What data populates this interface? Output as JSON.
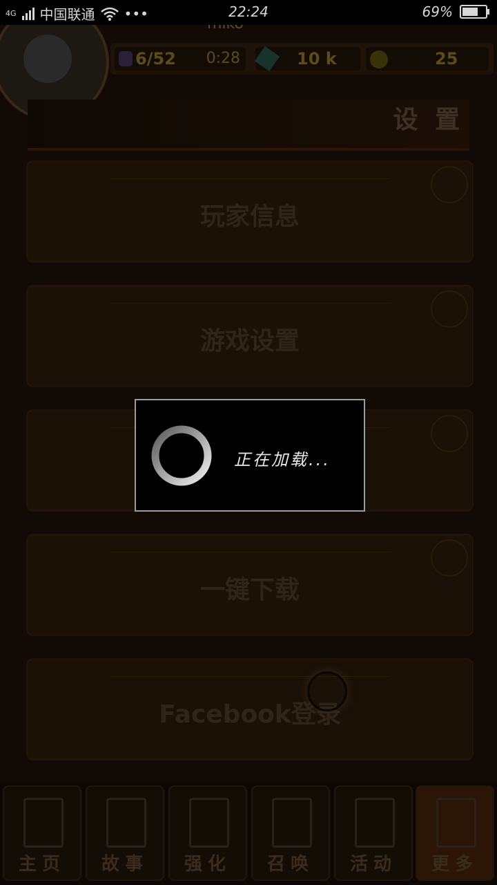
{
  "status_bar": {
    "network": "4G",
    "carrier": "中国联通",
    "more": "•••",
    "time": "22:24",
    "battery_text": "69%",
    "battery_level": 0.69
  },
  "game": {
    "player_name": "miko",
    "resources": {
      "stamina": "6/52",
      "timer": "0:28",
      "crystals": "10 k",
      "coins": "25"
    },
    "section_title": "设 置",
    "menu": [
      {
        "label": "玩家信息"
      },
      {
        "label": "游戏设置"
      },
      {
        "label": ""
      },
      {
        "label": "一键下载"
      },
      {
        "label": "Facebook登录"
      }
    ],
    "tabs": [
      {
        "label": "主页"
      },
      {
        "label": "故事"
      },
      {
        "label": "强化"
      },
      {
        "label": "召唤"
      },
      {
        "label": "活动"
      },
      {
        "label": "更多"
      }
    ]
  },
  "dialog": {
    "text": "正在加载..."
  }
}
